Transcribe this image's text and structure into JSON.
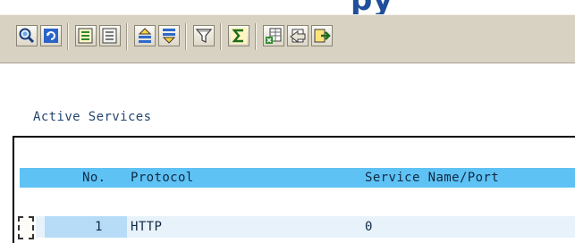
{
  "window": {
    "title_partial": "py"
  },
  "toolbar": {
    "buttons": [
      {
        "icon": "zoom-details-icon"
      },
      {
        "icon": "refresh-icon"
      },
      {
        "icon": "select-all-icon"
      },
      {
        "icon": "deselect-all-icon"
      },
      {
        "icon": "sort-ascending-icon"
      },
      {
        "icon": "sort-descending-icon"
      },
      {
        "icon": "filter-icon"
      },
      {
        "icon": "sum-icon"
      },
      {
        "icon": "export-spreadsheet-icon"
      },
      {
        "icon": "print-preview-icon"
      },
      {
        "icon": "export-local-file-icon"
      }
    ]
  },
  "section": {
    "title": "Active Services"
  },
  "table": {
    "columns": [
      "No.",
      "Protocol",
      "Service Name/Port"
    ],
    "rows": [
      {
        "no": "1",
        "protocol": "HTTP",
        "service": "0"
      }
    ]
  },
  "colors": {
    "toolbar_bg": "#d8d2c3",
    "header_bg": "#5fc2f4",
    "row_bg": "#e8f2fb",
    "selected_cell_bg": "#b6dcf8",
    "title_color": "#1f4f9a"
  }
}
